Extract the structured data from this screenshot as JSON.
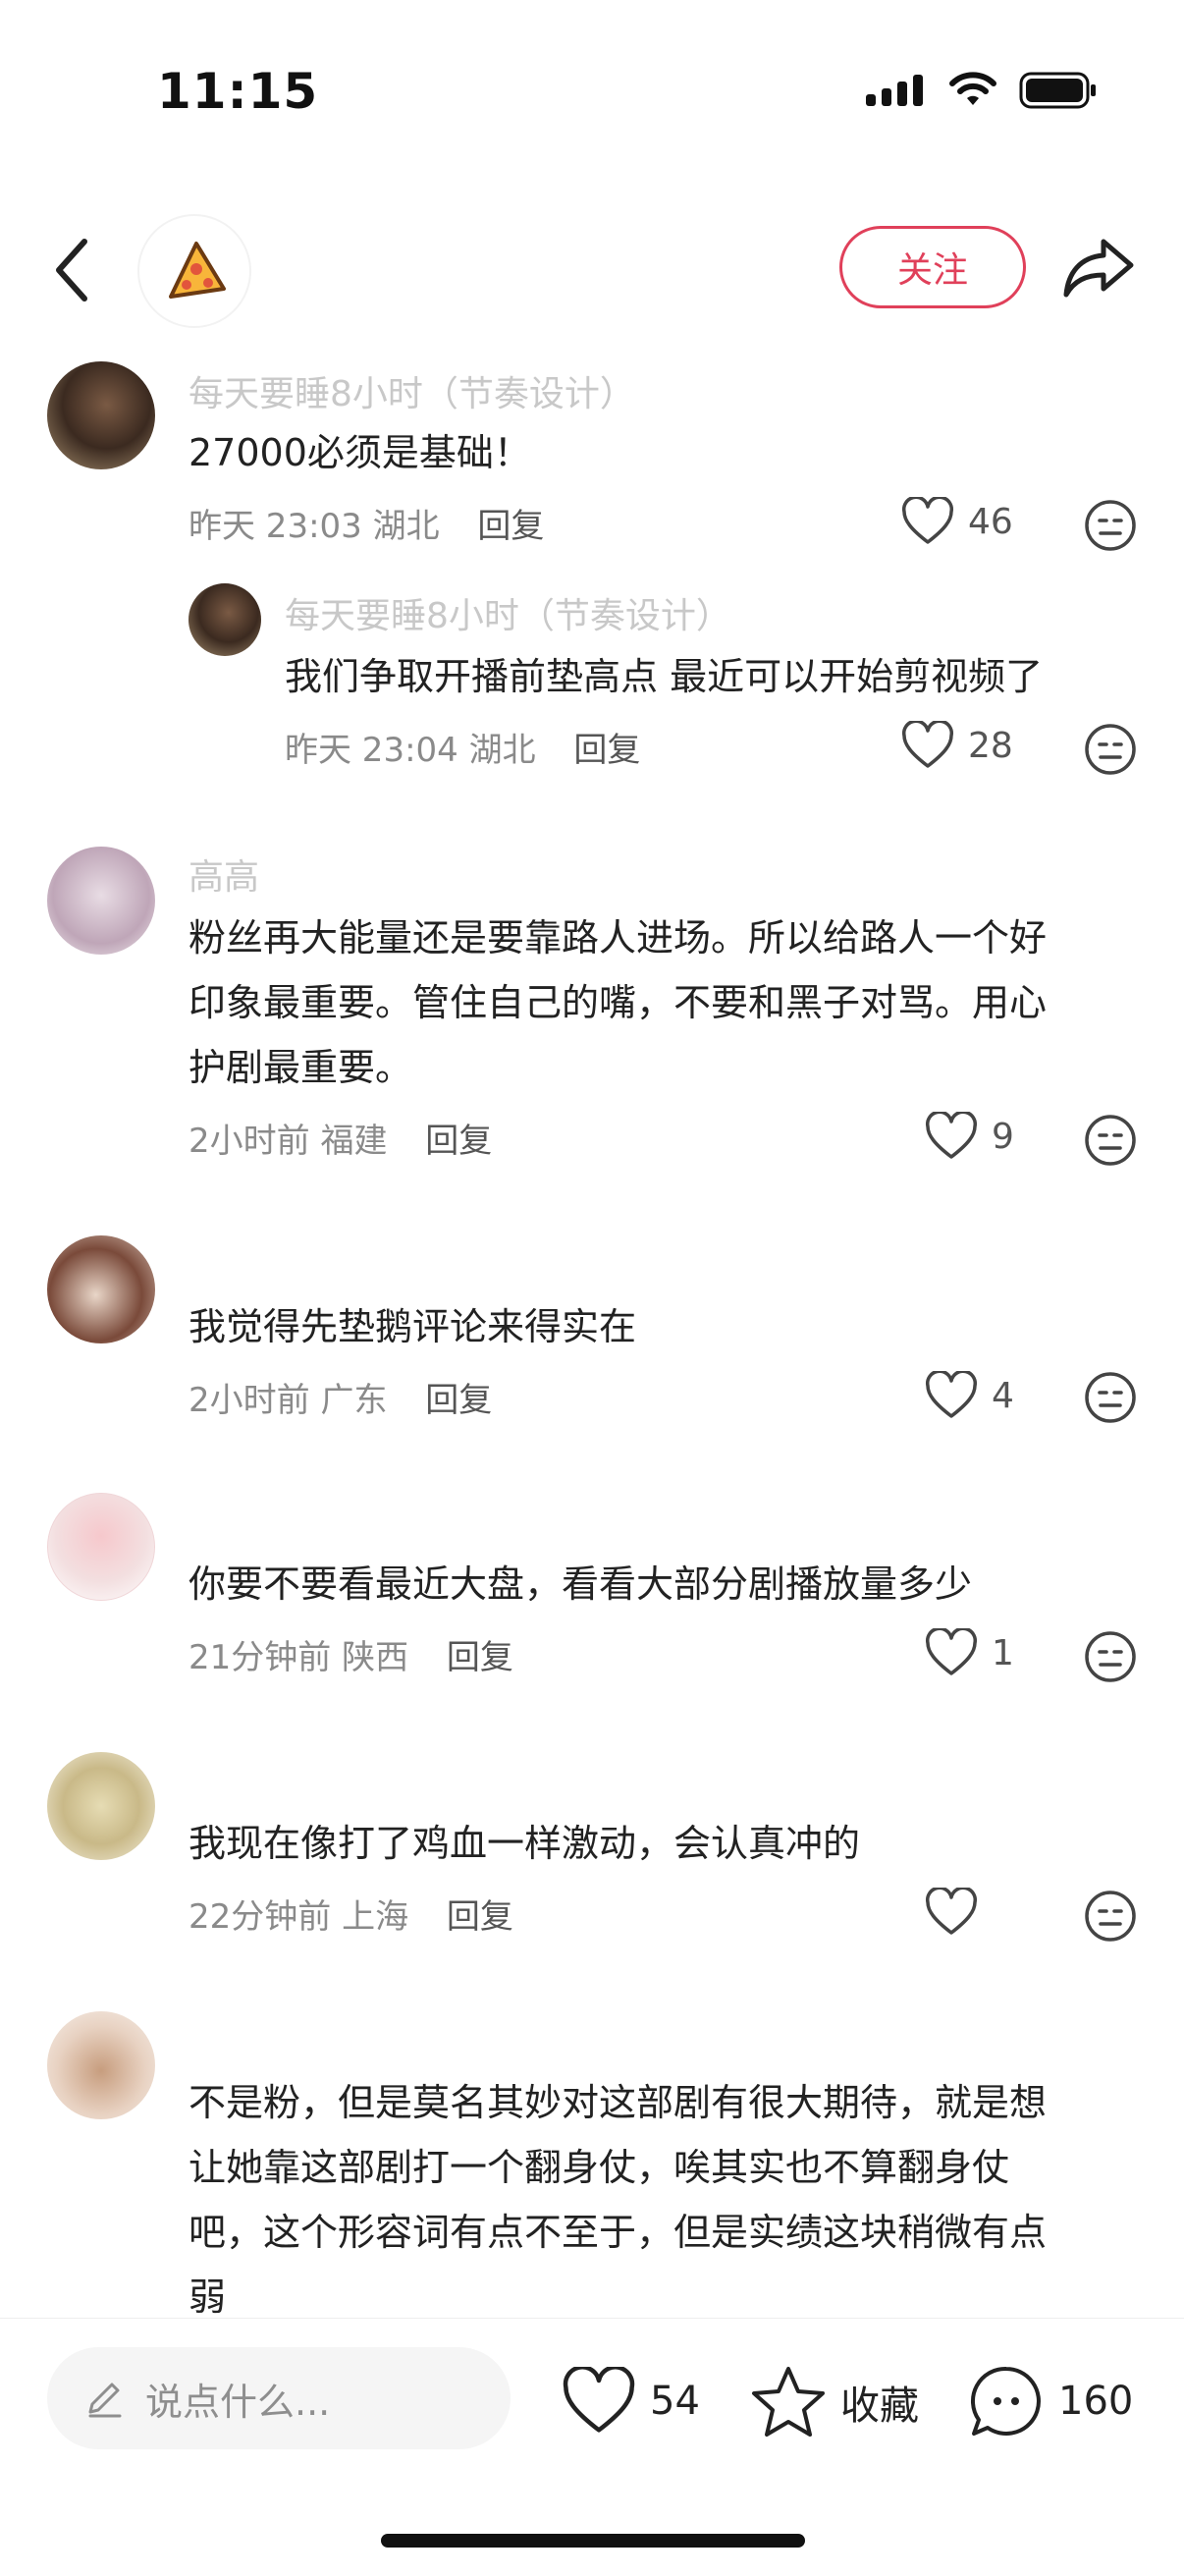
{
  "status_bar": {
    "time": "11:15"
  },
  "nav": {
    "follow_label": "关注"
  },
  "comments": [
    {
      "user": "每天要睡8小时（节奏设计）",
      "text": "27000必须是基础！",
      "time": "昨天 23:03",
      "location": "湖北",
      "reply": "回复",
      "likes": "46"
    },
    {
      "user": "每天要睡8小时（节奏设计）",
      "text": "我们争取开播前垫高点 最近可以开始剪视频了",
      "time": "昨天 23:04",
      "location": "湖北",
      "reply": "回复",
      "likes": "28"
    },
    {
      "user": "高高",
      "text_lines": [
        "粉丝再大能量还是要靠路人进场。所以给路人一个好",
        "印象最重要。管住自己的嘴，不要和黑子对骂。用心",
        "护剧最重要。"
      ],
      "time": "2小时前",
      "location": "福建",
      "reply": "回复",
      "likes": "9"
    },
    {
      "user": "",
      "text": "我觉得先垫鹅评论来得实在",
      "time": "2小时前",
      "location": "广东",
      "reply": "回复",
      "likes": "4"
    },
    {
      "user": "",
      "text": "你要不要看最近大盘，看看大部分剧播放量多少",
      "time": "21分钟前",
      "location": "陕西",
      "reply": "回复",
      "likes": "1"
    },
    {
      "user": "",
      "text": "我现在像打了鸡血一样激动，会认真冲的",
      "time": "22分钟前",
      "location": "上海",
      "reply": "回复",
      "likes": ""
    },
    {
      "user": "",
      "text_lines": [
        "不是粉，但是莫名其妙对这部剧有很大期待，就是想",
        "让她靠这部剧打一个翻身仗，唉其实也不算翻身仗",
        "吧，这个形容词有点不至于，但是实绩这块稍微有点",
        "弱"
      ],
      "time": "",
      "location": "",
      "reply": "",
      "likes": ""
    }
  ],
  "bottom_bar": {
    "input_placeholder": "说点什么...",
    "likes": "54",
    "favorite_label": "收藏",
    "comments": "160"
  },
  "icons": {
    "back": "chevron-left-icon",
    "share": "share-icon",
    "like": "heart-icon",
    "dislike": "meh-face-icon",
    "favorite": "star-icon",
    "comment": "chat-bubble-icon",
    "edit": "pencil-icon"
  },
  "colors": {
    "accent": "#e0405a"
  }
}
